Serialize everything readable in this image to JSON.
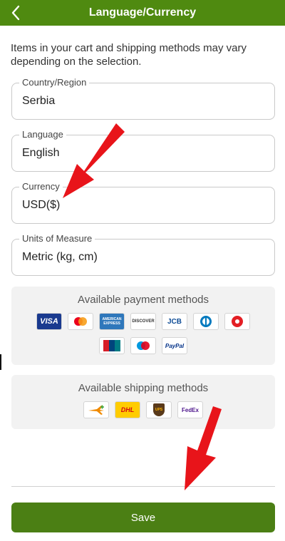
{
  "header": {
    "title": "Language/Currency"
  },
  "notice": "Items in your cart and shipping methods may vary depending on the selection.",
  "fields": [
    {
      "label": "Country/Region",
      "value": "Serbia"
    },
    {
      "label": "Language",
      "value": "English"
    },
    {
      "label": "Currency",
      "value": "USD($)"
    },
    {
      "label": "Units of Measure",
      "value": "Metric (kg, cm)"
    }
  ],
  "payment": {
    "title": "Available payment methods",
    "icons": [
      {
        "name": "visa-icon",
        "text": "VISA",
        "color": "#1a1f71"
      },
      {
        "name": "mastercard-icon",
        "text": "",
        "color": "#eb001b"
      },
      {
        "name": "amex-icon",
        "text": "AMERICAN EXPRESS",
        "color": "#2e77bb"
      },
      {
        "name": "discover-icon",
        "text": "DISCOVER",
        "color": "#333333"
      },
      {
        "name": "jcb-icon",
        "text": "JCB",
        "color": "#0e4c96"
      },
      {
        "name": "diners-club-icon",
        "text": "",
        "color": "#0079be"
      },
      {
        "name": "pagoefectivo-icon",
        "text": "",
        "color": "#e31e24"
      },
      {
        "name": "unionpay-icon",
        "text": "UnionPay",
        "color": "#d71e28"
      },
      {
        "name": "maestro-icon",
        "text": "",
        "color": "#0099df"
      },
      {
        "name": "paypal-icon",
        "text": "PayPal",
        "color": "#003087"
      }
    ]
  },
  "shipping": {
    "title": "Available shipping methods",
    "icons": [
      {
        "name": "airmail-icon",
        "text": "",
        "color": "#f08a00"
      },
      {
        "name": "dhl-icon",
        "text": "DHL",
        "color": "#d40511"
      },
      {
        "name": "ups-icon",
        "text": "UPS",
        "color": "#5a3a1a"
      },
      {
        "name": "fedex-icon",
        "text": "FedEx",
        "color": "#4d148c"
      }
    ]
  },
  "save_label": "Save",
  "colors": {
    "brand_green": "#4f8a10",
    "save_green": "#4b7f14",
    "arrow_red": "#e8141a"
  }
}
